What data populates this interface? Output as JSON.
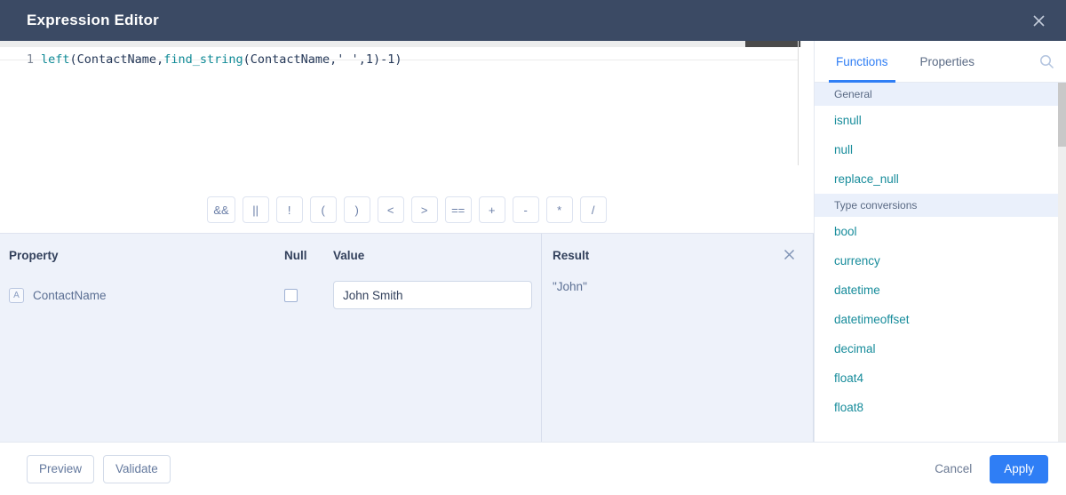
{
  "window": {
    "title": "Expression Editor",
    "close_icon": "close-icon"
  },
  "editor": {
    "line_number": "1",
    "expression": "left(ContactName,find_string(ContactName,' ',1)-1)",
    "tokens": [
      {
        "text": "left",
        "type": "fn"
      },
      {
        "text": "(",
        "type": "punct"
      },
      {
        "text": "ContactName",
        "type": "id"
      },
      {
        "text": ",",
        "type": "punct"
      },
      {
        "text": "find_string",
        "type": "fn"
      },
      {
        "text": "(",
        "type": "punct"
      },
      {
        "text": "ContactName",
        "type": "id"
      },
      {
        "text": ",",
        "type": "punct"
      },
      {
        "text": "' '",
        "type": "str"
      },
      {
        "text": ",",
        "type": "punct"
      },
      {
        "text": "1",
        "type": "num"
      },
      {
        "text": ")",
        "type": "punct"
      },
      {
        "text": "-",
        "type": "punct"
      },
      {
        "text": "1",
        "type": "num"
      },
      {
        "text": ")",
        "type": "punct"
      }
    ]
  },
  "operators": [
    "&&",
    "||",
    "!",
    "(",
    ")",
    "<",
    ">",
    "==",
    "+",
    "-",
    "*",
    "/"
  ],
  "property_table": {
    "headers": {
      "property": "Property",
      "null": "Null",
      "value": "Value"
    },
    "rows": [
      {
        "type_badge": "A",
        "name": "ContactName",
        "null_checked": false,
        "value": "John Smith"
      }
    ]
  },
  "result_panel": {
    "title": "Result",
    "value": "\"John\"",
    "close_icon": "close-icon"
  },
  "sidebar": {
    "tabs": [
      {
        "label": "Functions",
        "active": true
      },
      {
        "label": "Properties",
        "active": false
      }
    ],
    "search_icon": "search-icon",
    "groups": [
      {
        "label": "General",
        "items": [
          "isnull",
          "null",
          "replace_null"
        ]
      },
      {
        "label": "Type conversions",
        "items": [
          "bool",
          "currency",
          "datetime",
          "datetimeoffset",
          "decimal",
          "float4",
          "float8"
        ]
      }
    ]
  },
  "footer": {
    "preview_label": "Preview",
    "validate_label": "Validate",
    "cancel_label": "Cancel",
    "apply_label": "Apply"
  },
  "colors": {
    "titlebar": "#3b4a64",
    "accent": "#2f7ef5",
    "function_text": "#178c9b",
    "panel_bg": "#eef2fa"
  }
}
